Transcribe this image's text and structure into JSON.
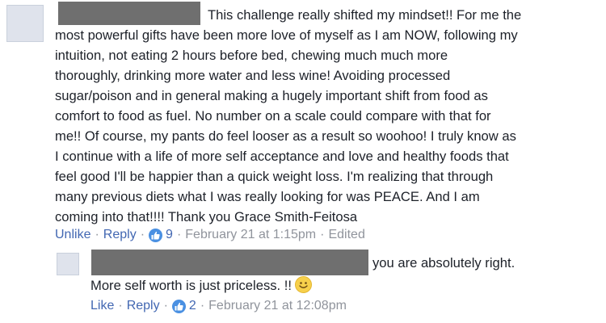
{
  "main_comment": {
    "text_first_line": "This challenge really shifted my mindset!! For me the",
    "text_lines": [
      "most powerful gifts have been more love of myself as I am NOW, following my",
      "intuition, not eating 2 hours before bed, chewing much much more",
      "thoroughly, drinking more water and less wine! Avoiding processed",
      "sugar/poison and in general making a hugely important shift from food as",
      "comfort to food as fuel. No number on a scale could compare with that for",
      "me!! Of course, my pants do feel looser as a result so woohoo! I truly know as",
      "I continue with a life of more self acceptance and love and healthy foods that",
      "feel good I'll be happier than a quick weight loss. I'm realizing that through",
      "many previous diets what I was really looking for was PEACE. And I am",
      "coming into that!!!! Thank you Grace Smith-Feitosa"
    ],
    "actions": {
      "unlike": "Unlike",
      "reply": "Reply",
      "reaction_count": "9",
      "timestamp": "February 21 at 1:15pm",
      "edited": "Edited"
    },
    "reaction_icon": "thumbs-up-icon"
  },
  "reply_comment": {
    "text_first_line": "you are absolutely right.",
    "text_second_line": "More self worth is just priceless. !!",
    "emoji": "smiley-emoji-icon",
    "actions": {
      "like": "Like",
      "reply": "Reply",
      "reaction_count": "2",
      "timestamp": "February 21 at 12:08pm"
    },
    "reaction_icon": "thumbs-up-icon"
  },
  "colors": {
    "text": "#1d2129",
    "link": "#4267b2",
    "meta": "#90949c",
    "redaction": "#6f6f6f",
    "like_badge": "#4a90e2"
  }
}
